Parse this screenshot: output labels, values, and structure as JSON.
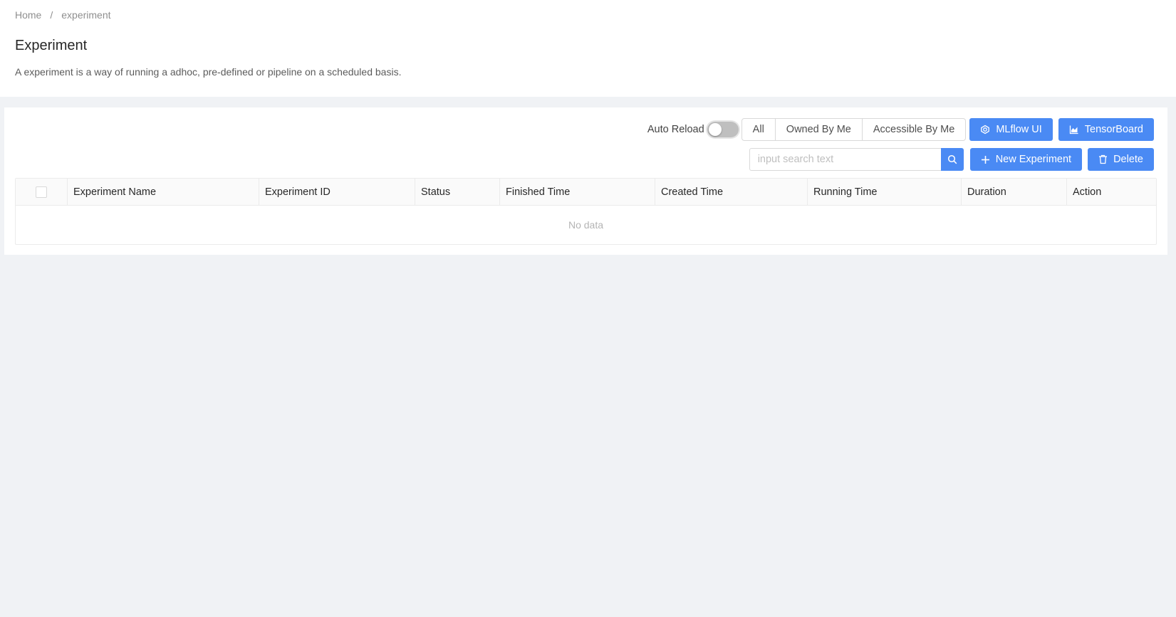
{
  "breadcrumb": {
    "home": "Home",
    "separator": "/",
    "current": "experiment"
  },
  "page": {
    "title": "Experiment",
    "description": "A experiment is a way of running a adhoc, pre-defined or pipeline on a scheduled basis."
  },
  "toolbar": {
    "auto_reload_label": "Auto Reload",
    "auto_reload_on": false,
    "filters": [
      "All",
      "Owned By Me",
      "Accessible By Me"
    ],
    "mlflow_label": "MLflow UI",
    "tensorboard_label": "TensorBoard",
    "search_placeholder": "input search text",
    "search_value": "",
    "new_label": "New Experiment",
    "delete_label": "Delete"
  },
  "table": {
    "columns": [
      "Experiment Name",
      "Experiment ID",
      "Status",
      "Finished Time",
      "Created Time",
      "Running Time",
      "Duration",
      "Action"
    ],
    "rows": [],
    "empty_text": "No data"
  },
  "colors": {
    "primary": "#4a8af4",
    "background": "#f0f2f5"
  },
  "icons": {
    "mlflow": "mlflow-icon",
    "tensorboard": "area-chart-icon",
    "search": "search-icon",
    "new": "plus-icon",
    "delete": "trash-icon"
  }
}
